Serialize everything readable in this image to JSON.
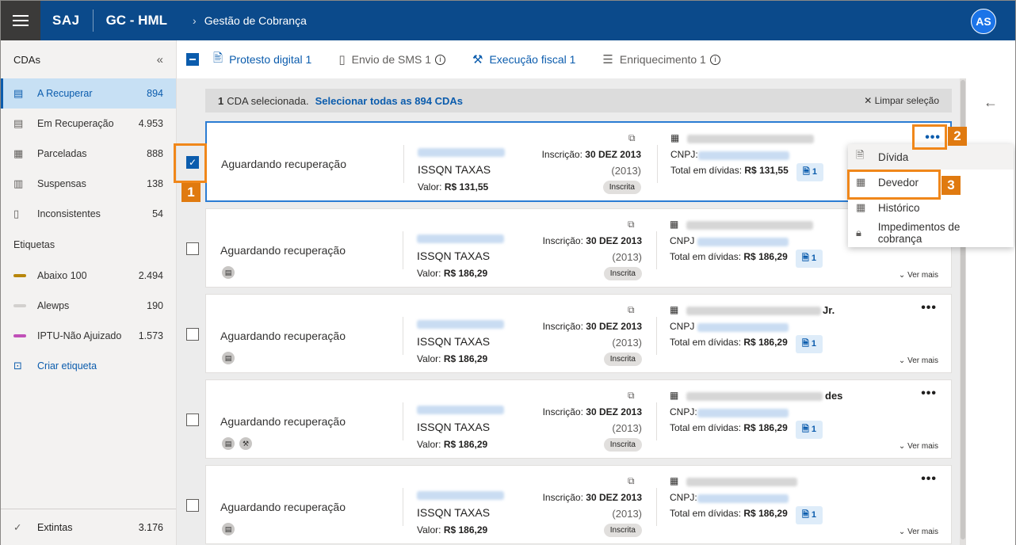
{
  "header": {
    "brand": "SAJ",
    "app": "GC - HML",
    "breadcrumb": "Gestão de Cobrança",
    "user_initials": "AS"
  },
  "sidebar": {
    "title": "CDAs",
    "items": [
      {
        "label": "A Recuperar",
        "count": "894"
      },
      {
        "label": "Em Recuperação",
        "count": "4.953"
      },
      {
        "label": "Parceladas",
        "count": "888"
      },
      {
        "label": "Suspensas",
        "count": "138"
      },
      {
        "label": "Inconsistentes",
        "count": "54"
      }
    ],
    "tags_title": "Etiquetas",
    "tags": [
      {
        "label": "Abaixo 100",
        "count": "2.494",
        "color": "#b8860b"
      },
      {
        "label": "Alewps",
        "count": "190",
        "color": "#d2d0ce"
      },
      {
        "label": "IPTU-Não Ajuizado",
        "count": "1.573",
        "color": "#c050b8"
      }
    ],
    "create_tag": "Criar etiqueta",
    "footer": {
      "label": "Extintas",
      "count": "3.176"
    }
  },
  "actions": {
    "protesto": "Protesto digital 1",
    "sms": "Envio de SMS 1",
    "execucao": "Execução fiscal 1",
    "enriquecimento": "Enriquecimento 1"
  },
  "selection": {
    "count": "1",
    "text": "CDA selecionada.",
    "select_all": "Selecionar todas as 894 CDAs",
    "clear": "Limpar seleção"
  },
  "card_labels": {
    "status": "Aguardando recuperação",
    "tributo": "ISSQN TAXAS",
    "valor_label": "Valor:",
    "inscricao_label": "Inscrição:",
    "inscricao_date": "30 DEZ 2013",
    "year": "(2013)",
    "pill": "Inscrita",
    "cnpj_label": "CNPJ:",
    "cnpj_label_short": "CNPJ",
    "total_label": "Total em dívidas:",
    "debts_count": "1",
    "ver_mais": "Ver mais"
  },
  "cards": [
    {
      "valor": "R$ 131,55",
      "total": "R$ 131,55",
      "name_suffix": ""
    },
    {
      "valor": "R$ 186,29",
      "total": "R$ 186,29",
      "name_suffix": ""
    },
    {
      "valor": "R$ 186,29",
      "total": "R$ 186,29",
      "name_suffix": "Jr."
    },
    {
      "valor": "R$ 186,29",
      "total": "R$ 186,29",
      "name_suffix": "des"
    },
    {
      "valor": "R$ 186,29",
      "total": "R$ 186,29",
      "name_suffix": ""
    }
  ],
  "menu": {
    "items": [
      "Dívida",
      "Devedor",
      "Histórico",
      "Impedimentos de cobrança"
    ]
  },
  "markers": [
    "1",
    "2",
    "3"
  ],
  "colors": {
    "header": "#0b4a8b",
    "accent": "#0b5cad",
    "marker": "#e07a10"
  }
}
